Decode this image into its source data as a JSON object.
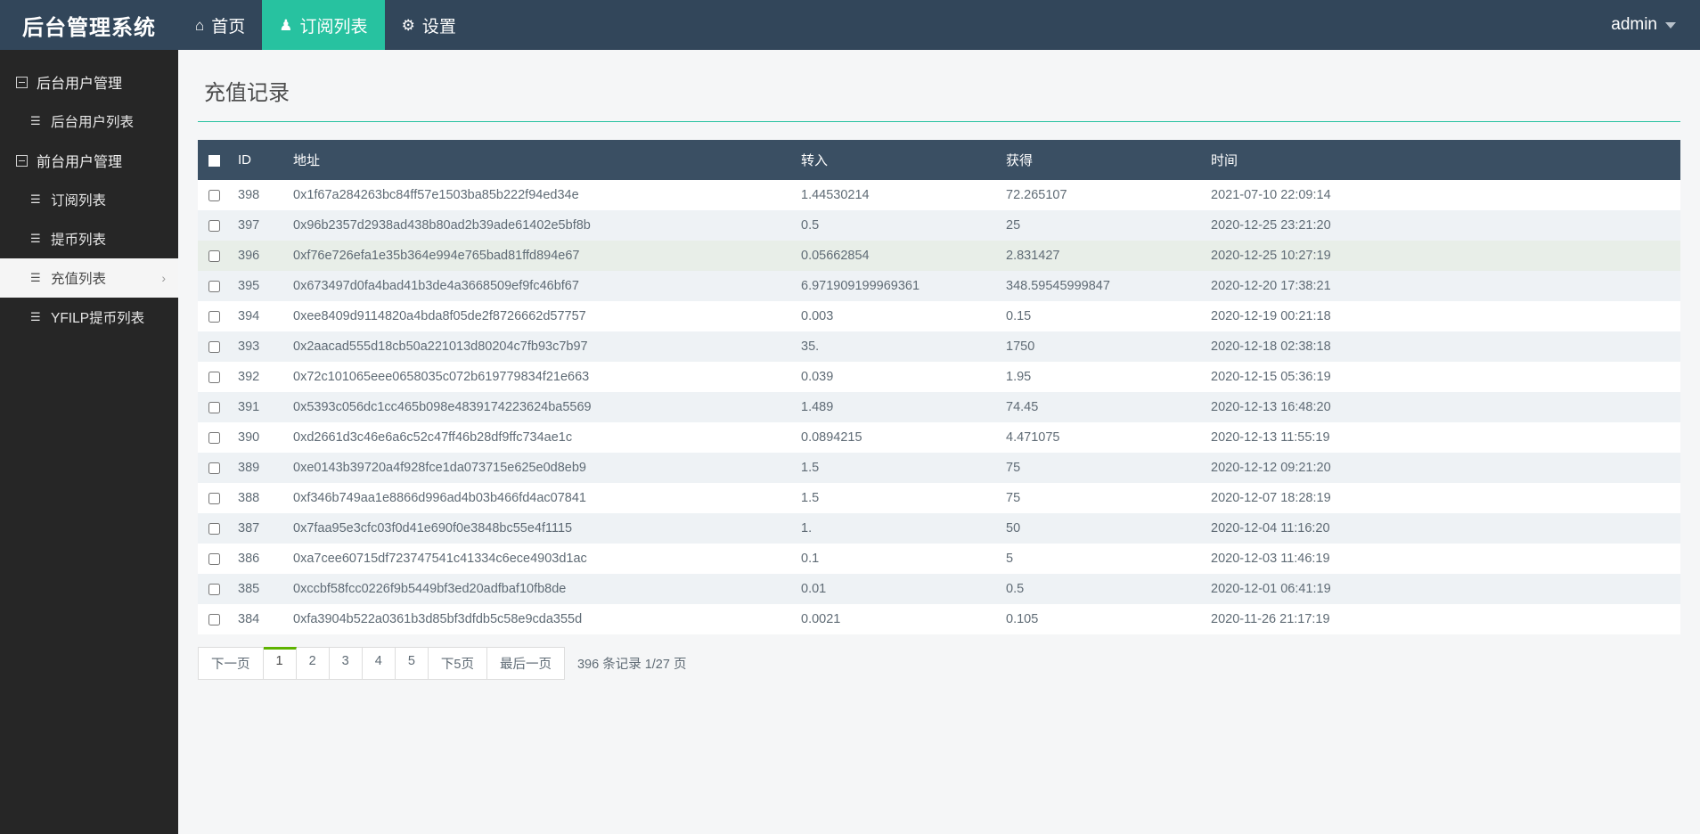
{
  "navbar": {
    "brand": "后台管理系统",
    "items": [
      {
        "label": "首页",
        "icon": "home-icon",
        "glyph": "⌂",
        "active": false
      },
      {
        "label": "订阅列表",
        "icon": "user-icon",
        "glyph": "♟",
        "active": true
      },
      {
        "label": "设置",
        "icon": "gear-icon",
        "glyph": "⚙",
        "active": false
      }
    ],
    "user": "admin"
  },
  "sidebar": {
    "groups": [
      {
        "label": "后台用户管理",
        "items": [
          {
            "label": "后台用户列表",
            "active": false
          }
        ]
      },
      {
        "label": "前台用户管理",
        "items": [
          {
            "label": "订阅列表",
            "active": false
          },
          {
            "label": "提币列表",
            "active": false
          },
          {
            "label": "充值列表",
            "active": true
          },
          {
            "label": "YFILP提币列表",
            "active": false
          }
        ]
      }
    ]
  },
  "page": {
    "title": "充值记录",
    "accent_color": "#27c2a0"
  },
  "table": {
    "columns": [
      "ID",
      "地址",
      "转入",
      "获得",
      "时间"
    ],
    "rows": [
      {
        "id": "398",
        "address": "0x1f67a284263bc84ff57e1503ba85b222f94ed34e",
        "in": "1.44530214",
        "get": "72.265107",
        "time": "2021-07-10 22:09:14"
      },
      {
        "id": "397",
        "address": "0x96b2357d2938ad438b80ad2b39ade61402e5bf8b",
        "in": "0.5",
        "get": "25",
        "time": "2020-12-25 23:21:20"
      },
      {
        "id": "396",
        "address": "0xf76e726efa1e35b364e994e765bad81ffd894e67",
        "in": "0.05662854",
        "get": "2.831427",
        "time": "2020-12-25 10:27:19"
      },
      {
        "id": "395",
        "address": "0x673497d0fa4bad41b3de4a3668509ef9fc46bf67",
        "in": "6.971909199969361",
        "get": "348.59545999847",
        "time": "2020-12-20 17:38:21"
      },
      {
        "id": "394",
        "address": "0xee8409d9114820a4bda8f05de2f8726662d57757",
        "in": "0.003",
        "get": "0.15",
        "time": "2020-12-19 00:21:18"
      },
      {
        "id": "393",
        "address": "0x2aacad555d18cb50a221013d80204c7fb93c7b97",
        "in": "35.",
        "get": "1750",
        "time": "2020-12-18 02:38:18"
      },
      {
        "id": "392",
        "address": "0x72c101065eee0658035c072b619779834f21e663",
        "in": "0.039",
        "get": "1.95",
        "time": "2020-12-15 05:36:19"
      },
      {
        "id": "391",
        "address": "0x5393c056dc1cc465b098e4839174223624ba5569",
        "in": "1.489",
        "get": "74.45",
        "time": "2020-12-13 16:48:20"
      },
      {
        "id": "390",
        "address": "0xd2661d3c46e6a6c52c47ff46b28df9ffc734ae1c",
        "in": "0.0894215",
        "get": "4.471075",
        "time": "2020-12-13 11:55:19"
      },
      {
        "id": "389",
        "address": "0xe0143b39720a4f928fce1da073715e625e0d8eb9",
        "in": "1.5",
        "get": "75",
        "time": "2020-12-12 09:21:20"
      },
      {
        "id": "388",
        "address": "0xf346b749aa1e8866d996ad4b03b466fd4ac07841",
        "in": "1.5",
        "get": "75",
        "time": "2020-12-07 18:28:19"
      },
      {
        "id": "387",
        "address": "0x7faa95e3cfc03f0d41e690f0e3848bc55e4f1115",
        "in": "1.",
        "get": "50",
        "time": "2020-12-04 11:16:20"
      },
      {
        "id": "386",
        "address": "0xa7cee60715df723747541c41334c6ece4903d1ac",
        "in": "0.1",
        "get": "5",
        "time": "2020-12-03 11:46:19"
      },
      {
        "id": "385",
        "address": "0xccbf58fcc0226f9b5449bf3ed20adfbaf10fb8de",
        "in": "0.01",
        "get": "0.5",
        "time": "2020-12-01 06:41:19"
      },
      {
        "id": "384",
        "address": "0xfa3904b522a0361b3d85bf3dfdb5c58e9cda355d",
        "in": "0.0021",
        "get": "0.105",
        "time": "2020-11-26 21:17:19"
      }
    ],
    "hovered_row_index": 2
  },
  "pagination": {
    "buttons": [
      {
        "label": "下一页",
        "active": false
      },
      {
        "label": "1",
        "active": true
      },
      {
        "label": "2",
        "active": false
      },
      {
        "label": "3",
        "active": false
      },
      {
        "label": "4",
        "active": false
      },
      {
        "label": "5",
        "active": false
      },
      {
        "label": "下5页",
        "active": false
      },
      {
        "label": "最后一页",
        "active": false
      }
    ],
    "info": "396 条记录 1/27 页"
  }
}
